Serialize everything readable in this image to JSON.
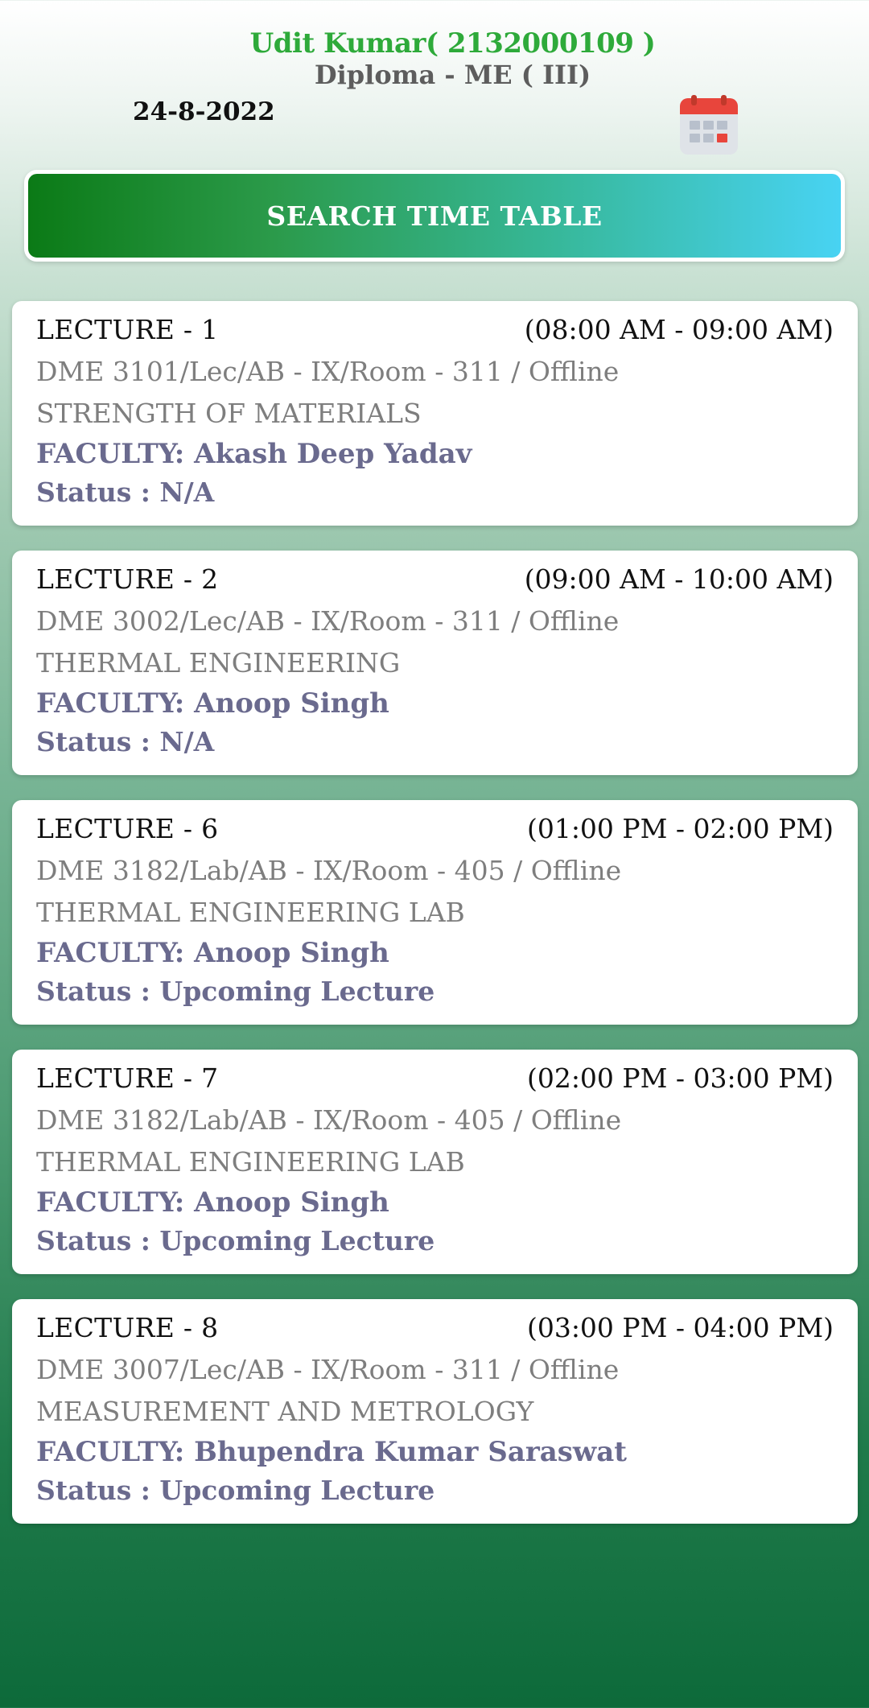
{
  "header": {
    "student": "Udit Kumar( 2132000109  )",
    "program": "Diploma - ME ( III)",
    "date": "24-8-2022",
    "calendar_icon": "calendar-icon"
  },
  "search": {
    "label": "SEARCH TIME TABLE"
  },
  "lectures": [
    {
      "title": "LECTURE  - 1",
      "time": "(08:00 AM - 09:00 AM)",
      "code": "DME 3101/Lec/AB - IX/Room - 311 / Offline",
      "subject": "STRENGTH OF MATERIALS",
      "faculty": "FACULTY: Akash Deep Yadav",
      "status": "Status : N/A"
    },
    {
      "title": "LECTURE  - 2",
      "time": "(09:00 AM - 10:00 AM)",
      "code": "DME 3002/Lec/AB - IX/Room - 311 / Offline",
      "subject": "THERMAL ENGINEERING",
      "faculty": "FACULTY: Anoop Singh",
      "status": "Status : N/A"
    },
    {
      "title": "LECTURE  - 6",
      "time": "(01:00 PM - 02:00 PM)",
      "code": "DME 3182/Lab/AB - IX/Room - 405 / Offline",
      "subject": "THERMAL ENGINEERING LAB",
      "faculty": "FACULTY: Anoop Singh",
      "status": "Status : Upcoming Lecture"
    },
    {
      "title": "LECTURE  - 7",
      "time": "(02:00 PM - 03:00 PM)",
      "code": "DME 3182/Lab/AB - IX/Room - 405 / Offline",
      "subject": "THERMAL ENGINEERING LAB",
      "faculty": "FACULTY: Anoop Singh",
      "status": "Status : Upcoming Lecture"
    },
    {
      "title": "LECTURE  - 8",
      "time": "(03:00 PM - 04:00 PM)",
      "code": "DME 3007/Lec/AB - IX/Room - 311 / Offline",
      "subject": "MEASUREMENT AND METROLOGY",
      "faculty": "FACULTY: Bhupendra Kumar Saraswat",
      "status": "Status : Upcoming Lecture"
    }
  ]
}
